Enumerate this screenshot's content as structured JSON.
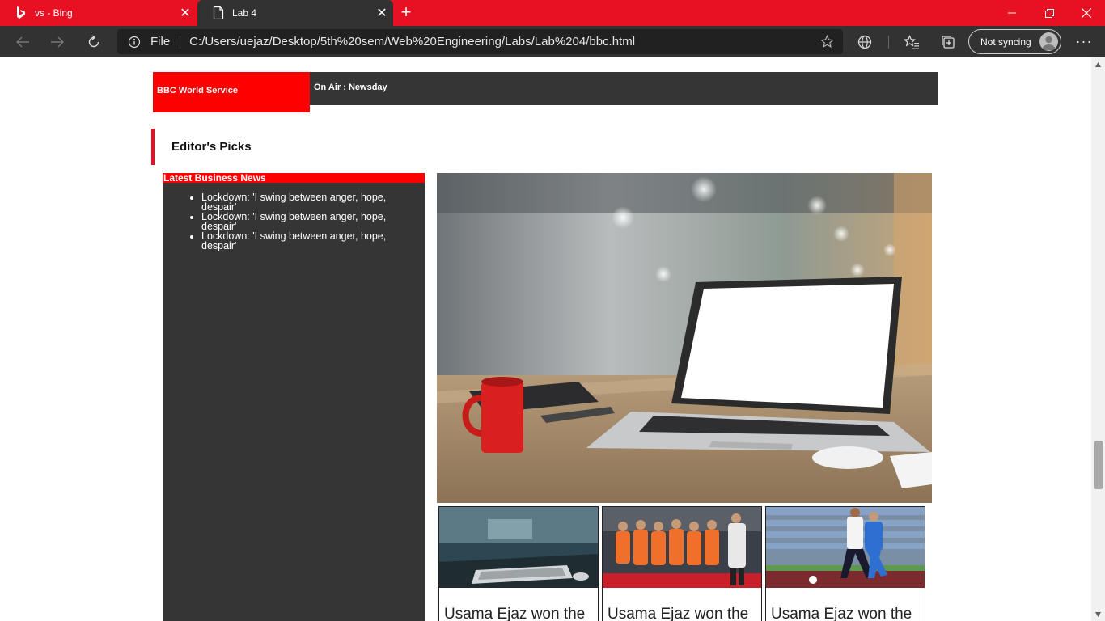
{
  "browser": {
    "tabs": [
      {
        "title": "vs - Bing",
        "icon": "bing-icon",
        "active": false
      },
      {
        "title": "Lab 4",
        "icon": "page-icon",
        "active": true
      }
    ],
    "address": {
      "scheme_label": "File",
      "url": "C:/Users/uejaz/Desktop/5th%20sem/Web%20Engineering/Labs/Lab%204/bbc.html"
    },
    "profile": {
      "sync_label": "Not syncing"
    },
    "accent_color": "#e81123"
  },
  "page": {
    "header": {
      "service_label": "BBC World Service",
      "on_air_label": "On Air : Newsday"
    },
    "section_title": "Editor's Picks",
    "business_news": {
      "heading": "Latest Business News",
      "items": [
        "Lockdown: 'I swing between anger, hope, despair'",
        "Lockdown: 'I swing between anger, hope, despair'",
        "Lockdown: 'I swing between anger, hope, despair'"
      ]
    },
    "hero_image": "laptop-desk-photo",
    "cards": [
      {
        "title": "Usama Ejaz won the",
        "image": "keyboard-photo"
      },
      {
        "title": "Usama Ejaz won the",
        "image": "football-team-photo"
      },
      {
        "title": "Usama Ejaz won the",
        "image": "football-match-photo"
      }
    ]
  }
}
